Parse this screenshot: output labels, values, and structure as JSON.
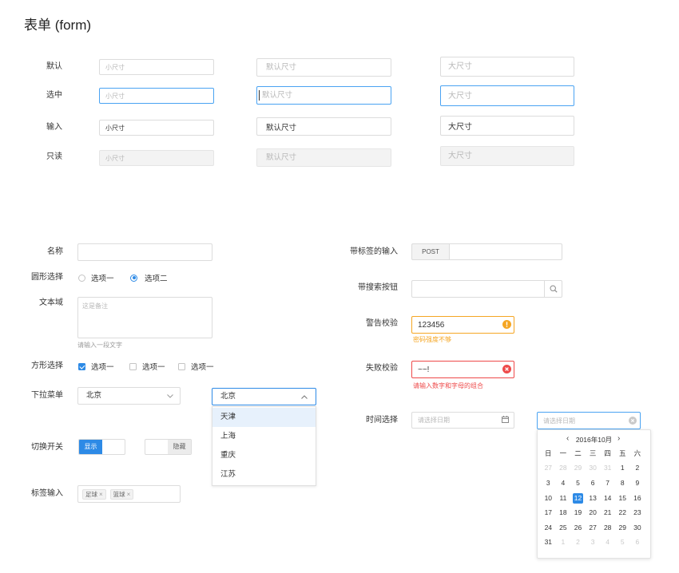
{
  "page": {
    "title": "表单 (form)"
  },
  "colors": {
    "primary": "#2d8ae6",
    "warning": "#f5a623",
    "error": "#ee4a4a",
    "focus": "#4aa3f2"
  },
  "sizes": {
    "rows": [
      {
        "label": "默认",
        "small": "小尺寸",
        "medium": "默认尺寸",
        "large": "大尺寸"
      },
      {
        "label": "选中",
        "small": "小尺寸",
        "medium": "默认尺寸",
        "large": "大尺寸"
      },
      {
        "label": "输入",
        "small": "小尺寸",
        "medium": "默认尺寸",
        "large": "大尺寸"
      },
      {
        "label": "只读",
        "small": "小尺寸",
        "medium": "默认尺寸",
        "large": "大尺寸"
      }
    ]
  },
  "form": {
    "name": {
      "label": "名称"
    },
    "radio": {
      "label": "圆形选择",
      "options": [
        {
          "text": "选项一",
          "checked": false
        },
        {
          "text": "选项二",
          "checked": true
        }
      ]
    },
    "textarea": {
      "label": "文本域",
      "placeholder": "这是备注",
      "hint": "请输入一段文字"
    },
    "checkbox": {
      "label": "方形选择",
      "options": [
        {
          "text": "选项一",
          "checked": true
        },
        {
          "text": "选项一",
          "checked": false
        },
        {
          "text": "选项一",
          "checked": false
        }
      ]
    },
    "select": {
      "label": "下拉菜单",
      "closed_value": "北京",
      "open_value": "北京",
      "options": [
        "天津",
        "上海",
        "重庆",
        "江苏"
      ],
      "highlighted": "天津",
      "icon_closed": "chevron-down-icon",
      "icon_open": "chevron-up-icon"
    },
    "switch": {
      "label": "切换开关",
      "items": [
        {
          "text": "显示",
          "on": true
        },
        {
          "text": "隐藏",
          "on": false
        }
      ]
    },
    "tags": {
      "label": "标签输入",
      "items": [
        "足球",
        "篮球"
      ],
      "close_glyph": "×"
    },
    "addon_input": {
      "label": "带标签的输入",
      "addon": "POST"
    },
    "search_input": {
      "label": "带搜索按钮",
      "icon": "search-icon"
    },
    "warning": {
      "label": "警告校验",
      "value": "123456",
      "message": "密码强度不够",
      "icon": "warning-icon"
    },
    "error": {
      "label": "失败校验",
      "value": "~~!",
      "message": "请输入数字和字母的组合",
      "icon": "error-icon"
    },
    "date": {
      "label": "时间选择",
      "inputs": [
        {
          "placeholder": "请选择日期",
          "icon": "calendar-icon"
        },
        {
          "placeholder": "请选择日期",
          "icon": "clear-icon"
        }
      ]
    },
    "calendar": {
      "prev": "‹",
      "title": "2016年10月",
      "next": "›",
      "weekdays": [
        "日",
        "一",
        "二",
        "三",
        "四",
        "五",
        "六"
      ],
      "selected": "12",
      "weeks": [
        [
          {
            "day": "27",
            "muted": true
          },
          {
            "day": "28",
            "muted": true
          },
          {
            "day": "29",
            "muted": true
          },
          {
            "day": "30",
            "muted": true
          },
          {
            "day": "31",
            "muted": true
          },
          {
            "day": "1"
          },
          {
            "day": "2"
          }
        ],
        [
          {
            "day": "3"
          },
          {
            "day": "4"
          },
          {
            "day": "5"
          },
          {
            "day": "6"
          },
          {
            "day": "7"
          },
          {
            "day": "8"
          },
          {
            "day": "9"
          }
        ],
        [
          {
            "day": "10"
          },
          {
            "day": "11"
          },
          {
            "day": "12"
          },
          {
            "day": "13"
          },
          {
            "day": "14"
          },
          {
            "day": "15"
          },
          {
            "day": "16"
          }
        ],
        [
          {
            "day": "17"
          },
          {
            "day": "18"
          },
          {
            "day": "19"
          },
          {
            "day": "20"
          },
          {
            "day": "21"
          },
          {
            "day": "22"
          },
          {
            "day": "23"
          }
        ],
        [
          {
            "day": "24"
          },
          {
            "day": "25"
          },
          {
            "day": "26"
          },
          {
            "day": "27"
          },
          {
            "day": "28"
          },
          {
            "day": "29"
          },
          {
            "day": "30"
          }
        ],
        [
          {
            "day": "31"
          },
          {
            "day": "1",
            "muted": true
          },
          {
            "day": "2",
            "muted": true
          },
          {
            "day": "3",
            "muted": true
          },
          {
            "day": "4",
            "muted": true
          },
          {
            "day": "5",
            "muted": true
          },
          {
            "day": "6",
            "muted": true
          }
        ]
      ]
    }
  }
}
